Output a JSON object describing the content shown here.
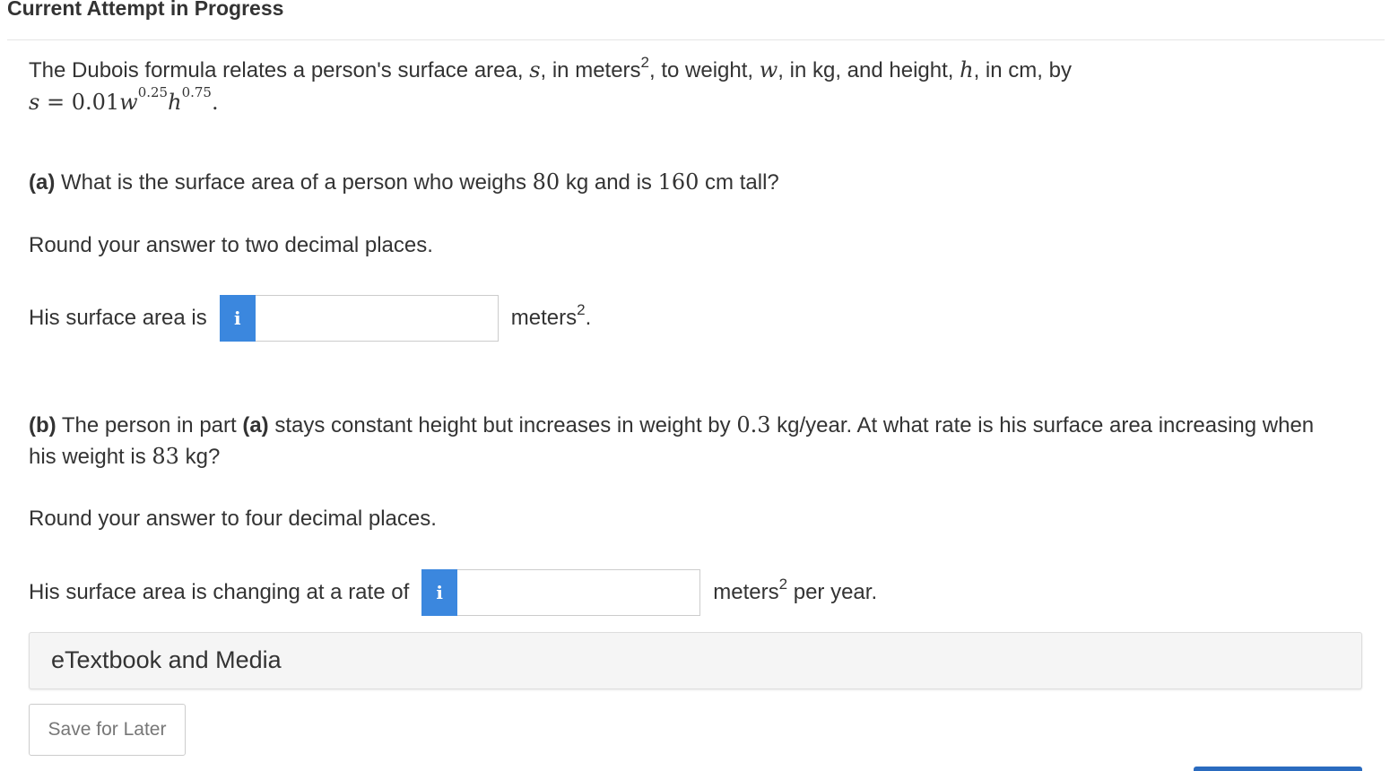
{
  "header": {
    "title": "Current Attempt in Progress"
  },
  "intro": {
    "text_1": "The Dubois formula relates a person's surface area, ",
    "var_s": "s",
    "text_2": ", in meters",
    "sup_2": "2",
    "text_3": ", to weight, ",
    "var_w": "w",
    "text_4": ", in kg, and height, ",
    "var_h": "h",
    "text_5": ", in cm, by"
  },
  "formula": {
    "lhs": "s",
    "eq": " = ",
    "coef": "0.01",
    "w": "w",
    "w_exp": "0.25",
    "h": "h",
    "h_exp": "0.75",
    "end": "."
  },
  "part_a": {
    "label": "(a)",
    "q_1": " What is the surface area of a person who weighs ",
    "weight": "80",
    "q_2": " kg and is ",
    "height": "160",
    "q_3": " cm tall?",
    "rounding": "Round your answer to two decimal places.",
    "answer_label": "His surface area is",
    "info_icon": "i",
    "input_value": "",
    "unit": "meters",
    "unit_sup": "2",
    "unit_end": "."
  },
  "part_b": {
    "label": "(b)",
    "q_1": " The person in part ",
    "ref": "(a)",
    "q_2": " stays constant height but increases in weight by ",
    "rate": "0.3",
    "q_3": " kg/year. At what rate is his surface area increasing when",
    "q_4": "his weight is ",
    "weight": "83",
    "q_5": " kg?",
    "rounding": "Round your answer to four decimal places.",
    "answer_label": "His surface area is changing at a rate of",
    "info_icon": "i",
    "input_value": "",
    "unit": "meters",
    "unit_sup": "2",
    "unit_end": " per year."
  },
  "media": {
    "title": "eTextbook and Media"
  },
  "actions": {
    "save_label": "Save for Later"
  },
  "colors": {
    "info_button": "#3b87de",
    "accent_bar": "#2a6bbf"
  }
}
